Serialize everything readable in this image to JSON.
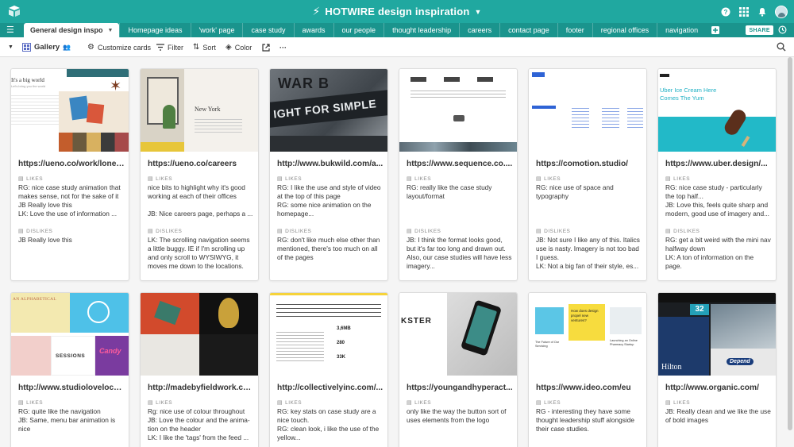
{
  "app": {
    "title": "HOTWIRE design inspiration",
    "accent": "#20a8a0",
    "tab_bar_color": "#1a948d"
  },
  "tabs": [
    {
      "label": "General design inspo",
      "active": true
    },
    {
      "label": "Homepage ideas"
    },
    {
      "label": "'work' page"
    },
    {
      "label": "case study"
    },
    {
      "label": "awards"
    },
    {
      "label": "our people"
    },
    {
      "label": "thought leadership"
    },
    {
      "label": "careers"
    },
    {
      "label": "contact page"
    },
    {
      "label": "footer"
    },
    {
      "label": "regional offices"
    },
    {
      "label": "navigation"
    }
  ],
  "share_label": "SHARE",
  "toolbar": {
    "view_name": "Gallery",
    "customize": "Customize cards",
    "filter": "Filter",
    "sort": "Sort",
    "color": "Color",
    "more": "···"
  },
  "fields": {
    "likes": "LIKES",
    "dislikes": "DISLIKES"
  },
  "cards": [
    {
      "title": "https://ueno.co/work/lonel...",
      "likes": "RG: nice case study animation that makes sense, not for the sake of it\nJB Really love this\nLK: Love the use of information ...",
      "dislikes": "JB Really love this"
    },
    {
      "title": "https://ueno.co/careers",
      "likes": "nice bits to highlight why it's good working at each of their offices\n\nJB: Nice careers page, perhaps a ...",
      "dislikes": "LK: The scrolling navigation seems a little buggy. IE if I'm scrolling up and only scroll to WYSIWYG, it moves me down to the locations."
    },
    {
      "title": "http://www.bukwild.com/a...",
      "likes": "RG: I like the use and style of video at the top of this page\nRG: some nice animation on the homepage...",
      "dislikes": "RG: don't like much else other than mentioned, there's too much on all of the pages"
    },
    {
      "title": "https://www.sequence.co....",
      "likes": "RG: really like the case study layout/format",
      "dislikes": "JB: I think the format looks good, but it's far too long and drawn out. Also, our case studies will have less imagery..."
    },
    {
      "title": "https://comotion.studio/",
      "likes": "RG: nice use of space and typography",
      "dislikes": "JB: Not sure I like any of this. Italics use is nasty. Imagery is not too bad I guess.\nLK: Not a big fan of their style, es..."
    },
    {
      "title": "https://www.uber.design/...",
      "likes": "RG: nice case study - particularly the top half...\nJB: Love this, feels quite sharp and modern, good use of imagery and...",
      "dislikes": "RG: get a bit weird with the mini nav halfway down\nLK: A ton of information on the page."
    },
    {
      "title": "http://www.studiolovelock...",
      "likes": "RG: quite like the navigation\nJB: Same, menu bar animation is nice"
    },
    {
      "title": "http://madebyfieldwork.co...",
      "likes": "Rg: nice use of colour throughout\nJB: Love the colour and the anima-tion on the header\nLK: I like the 'tags' from the feed ..."
    },
    {
      "title": "http://collectivelyinc.com/...",
      "likes": "RG: key stats on case study are a nice touch.\nRG: clean look, i like the use of the yellow..."
    },
    {
      "title": "https://youngandhyperact...",
      "likes": "only like the way the button sort of uses elements from the logo"
    },
    {
      "title": "https://www.ideo.com/eu",
      "likes": "RG - interesting they have some thought leadership stuff alongside their case studies."
    },
    {
      "title": "http://www.organic.com/",
      "likes": "JB: Really clean and we like the use of bold images"
    }
  ],
  "thumbs": {
    "t1_heading": "It's a big world",
    "t1_sub": "Let's bring you the world",
    "t2_heading": "New York",
    "t3_sign_a": "WAR B",
    "t3_sign_b": "IGHT FOR SIMPLE",
    "t6_heading": "Uber Ice Cream Here Comes The Yum",
    "t7_heading": "AN ALPHABETICAL",
    "t7_sessions": "SESSIONS",
    "t7_candy": "Candy",
    "t9_stats": [
      "3,6MB",
      "280",
      "33K"
    ],
    "t10_heading": "KSTER",
    "t11_q": "How does design propel new ventures?",
    "t11_a": "The Future of Our Servicing",
    "t11_b": "Launching an Online Pharmacy Startup",
    "t12_num": "32",
    "t12_hilton": "Hilton",
    "t12_depend": "Depend"
  }
}
